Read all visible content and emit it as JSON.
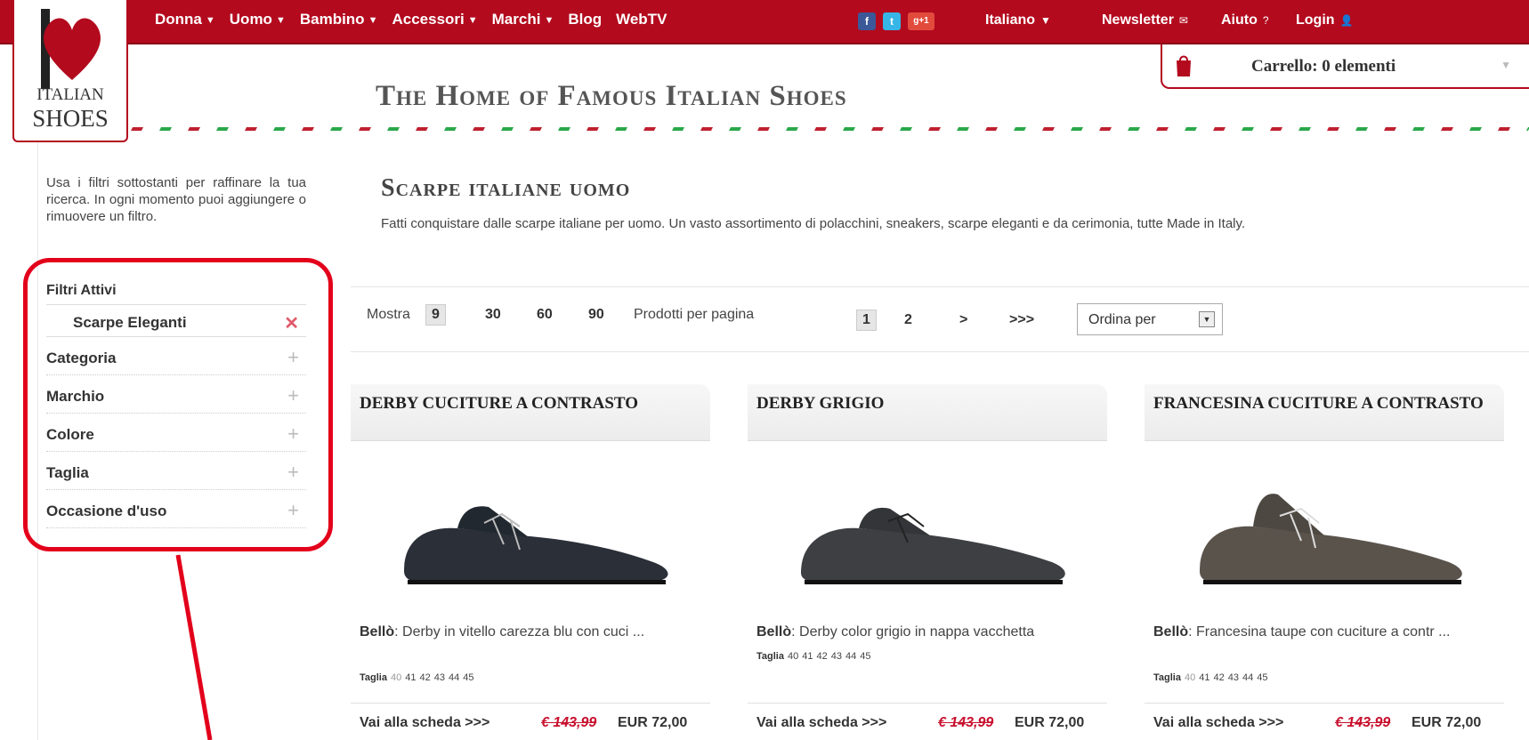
{
  "nav": {
    "items": [
      {
        "label": "Donna",
        "arrow": "▼"
      },
      {
        "label": "Uomo",
        "arrow": "▼"
      },
      {
        "label": "Bambino",
        "arrow": "▼"
      },
      {
        "label": "Accessori",
        "arrow": "▼"
      },
      {
        "label": "Marchi",
        "arrow": "▼"
      },
      {
        "label": "Blog",
        "arrow": ""
      },
      {
        "label": "WebTV",
        "arrow": ""
      }
    ],
    "social": {
      "facebook": "f",
      "twitter": "t",
      "gplus": "g+1"
    },
    "language": "Italiano",
    "language_arrow": "▼",
    "newsletter": "Newsletter",
    "newsletter_icon": "✉",
    "help": "Aiuto",
    "help_icon": "?",
    "login": "Login",
    "login_icon": "👤"
  },
  "logo": {
    "line1": "ITALIAN",
    "line2": "SHOES"
  },
  "tagline": "The Home of Famous Italian Shoes",
  "cart": {
    "label": "Carrello: 0 elementi",
    "chevron": "▼"
  },
  "sidebar": {
    "intro": "Usa i filtri sottostanti per raffinare la tua ricerca. In ogni momento puoi aggiungere o rimuovere un filtro.",
    "active_title": "Filtri Attivi",
    "active_filter": "Scarpe Eleganti",
    "remove_icon": "✕",
    "filters": [
      "Categoria",
      "Marchio",
      "Colore",
      "Taglia",
      "Occasione d'uso"
    ],
    "add_icon": "+"
  },
  "main": {
    "title": "Scarpe italiane uomo",
    "description": "Fatti conquistare dalle scarpe italiane per uomo. Un vasto assortimento di polacchini, sneakers, scarpe eleganti e da cerimonia, tutte Made in Italy.",
    "toolbar": {
      "show_label": "Mostra",
      "per_page_options": [
        "9",
        "30",
        "60",
        "90"
      ],
      "per_page_selected": "9",
      "per_page_label": "Prodotti per pagina",
      "pages": [
        "1",
        "2",
        ">",
        ">>>"
      ],
      "current_page": "1",
      "sort_label": "Ordina per",
      "sort_icon": "▼"
    }
  },
  "products": [
    {
      "name": "DERBY CUCITURE A CONTRASTO",
      "brand": "Bellò",
      "desc": ": Derby in vitello carezza blu con cuci ...",
      "size_label": "Taglia",
      "sizes": [
        "40",
        "41",
        "42",
        "43",
        "44",
        "45"
      ],
      "more": "Vai alla scheda >>>",
      "old_price": "€ 143,99",
      "price": "EUR 72,00",
      "color": "#2a2f38"
    },
    {
      "name": "DERBY GRIGIO",
      "brand": "Bellò",
      "desc": ": Derby color grigio in nappa vacchetta",
      "size_label": "Taglia",
      "sizes": [
        "40",
        "41",
        "42",
        "43",
        "44",
        "45"
      ],
      "more": "Vai alla scheda >>>",
      "old_price": "€ 143,99",
      "price": "EUR 72,00",
      "color": "#3d3f42"
    },
    {
      "name": "FRANCESINA CUCITURE A CONTRASTO",
      "brand": "Bellò",
      "desc": ": Francesina taupe con cuciture a contr ...",
      "size_label": "Taglia",
      "sizes": [
        "40",
        "41",
        "42",
        "43",
        "44",
        "45"
      ],
      "more": "Vai alla scheda >>>",
      "old_price": "€ 143,99",
      "price": "EUR 72,00",
      "color": "#5a534c"
    }
  ],
  "colors": {
    "brand_red": "#b30a1e",
    "annotation_red": "#e3001b",
    "sale_red": "#c8102e"
  }
}
